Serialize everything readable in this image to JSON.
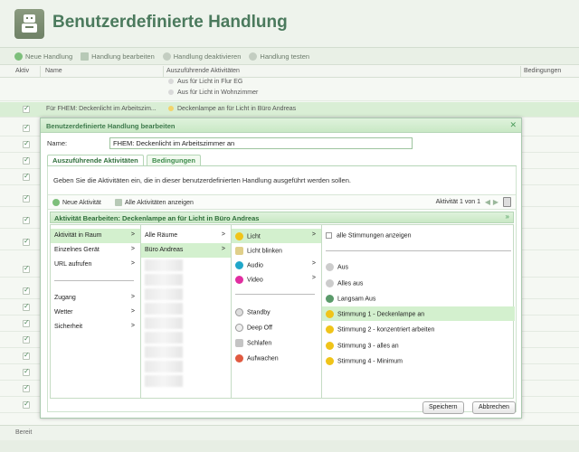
{
  "header": {
    "title": "Benutzerdefinierte Handlung"
  },
  "toolbar": {
    "new": "Neue Handlung",
    "edit": "Handlung bearbeiten",
    "deactivate": "Handlung deaktivieren",
    "test": "Handlung testen"
  },
  "columns": {
    "active": "Aktiv",
    "name": "Name",
    "actions": "Auszuführende Aktivitäten",
    "conditions": "Bedingungen"
  },
  "bg_rows": {
    "r0_act1": "Aus für Licht in Flur EG",
    "r0_act2": "Aus für Licht in Wohnzimmer",
    "r1_name": "Für FHEM: Deckenlicht im Arbeitszim...",
    "r1_act": "Deckenlampe an für Licht in Büro Andreas"
  },
  "status": {
    "text": "Bereit"
  },
  "dialog": {
    "title": "Benutzerdefinierte Handlung bearbeiten",
    "name_label": "Name:",
    "name_value": "FHEM: Deckenlicht im Arbeitszimmer an",
    "tab_actions": "Auszuführende Aktivitäten",
    "tab_conditions": "Bedingungen",
    "info": "Geben Sie die Aktivitäten ein, die in dieser benutzerdefinierten Handlung ausgeführt werden sollen.",
    "new_activity": "Neue Aktivität",
    "show_all": "Alle Aktivitäten anzeigen",
    "page_info": "Aktivität 1 von 1",
    "edit_title": "Aktivität Bearbeiten: Deckenlampe an für Licht in Büro Andreas",
    "save": "Speichern",
    "cancel": "Abbrechen"
  },
  "col1": {
    "i0": "Aktivität in Raum",
    "i1": "Einzelnes Gerät",
    "i2": "URL aufrufen",
    "i3": "Zugang",
    "i4": "Wetter",
    "i5": "Sicherheit"
  },
  "col2": {
    "i0": "Alle Räume",
    "i1": "Büro Andreas"
  },
  "col3": {
    "i0": "Licht",
    "i1": "Licht blinken",
    "i2": "Audio",
    "i3": "Video",
    "i4": "Standby",
    "i5": "Deep Off",
    "i6": "Schlafen",
    "i7": "Aufwachen"
  },
  "col4": {
    "show_all": "alle Stimmungen anzeigen",
    "i0": "Aus",
    "i1": "Alles aus",
    "i2": "Langsam Aus",
    "i3": "Stimmung 1 - Deckenlampe an",
    "i4": "Stimmung 2 - konzentriert arbeiten",
    "i5": "Stimmung 3 - alles an",
    "i6": "Stimmung 4 - Minimum"
  },
  "colors": {
    "accent": "#4b7a5d",
    "selection": "#d3f0ce",
    "header_green": "#c9e8c5"
  }
}
